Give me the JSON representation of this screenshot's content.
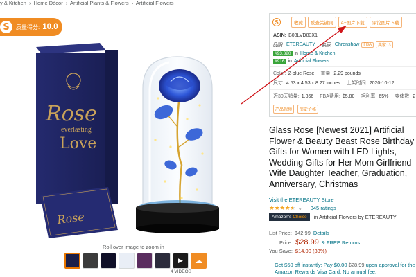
{
  "breadcrumb": [
    "y & Kitchen",
    "›",
    "Home Décor",
    "›",
    "Artificial Plants & Flowers",
    "›",
    "Artificial Flowers"
  ],
  "score": {
    "logo": "S",
    "label": "质量得分:",
    "value": "10.0"
  },
  "gallery": {
    "zoom_hint": "Roll over image to zoom in",
    "videos_label": "4 VIDEOS",
    "box_text_rose": "Rose",
    "box_text_everlasting": "everlasting",
    "box_text_love": "Love",
    "card_text": "Rose"
  },
  "panel": {
    "logo": "S",
    "tools": [
      "收藏",
      "反查关键词",
      "A+图片下载",
      "评论图片下载"
    ],
    "asin_label": "ASIN:",
    "asin": "B08LVD83X1",
    "brand_label": "品牌:",
    "brand": "ETEREAUTY",
    "seller_label": "卖家:",
    "seller": "Chrenshaw",
    "fba_tag": "FBA",
    "seller_count_tag": "卖家: 3",
    "rank1": "#93,320",
    "rank1_in": "in",
    "rank1_cat": "Home & Kitchen",
    "rank2": "#916",
    "rank2_in": "in",
    "rank2_cat": "Artificial Flowers",
    "color_label": "Color:",
    "color": "2-blue Rose",
    "weight_label": "重量:",
    "weight": "2.29 pounds",
    "size_label": "尺寸:",
    "size": "4.53 x 4.53 x 8.27 inches",
    "date_label": "上架时间:",
    "date": "2020-10-12",
    "sales_label": "近30天销量:",
    "sales": "1,866",
    "fba_fee_label": "FBA费用:",
    "fba_fee": "$5.80",
    "margin_label": "毛利率:",
    "margin": "65%",
    "variants_label": "变体数:",
    "variants": "2",
    "bottom_tags": [
      "产品视频",
      "历史价格"
    ]
  },
  "product": {
    "title_lines": [
      "Glass Rose [Newest 2021] Artificial",
      "Flower & Beauty Beast Rose Birthday",
      "Gifts for Women with LED Lights,",
      "Wedding Gifts for Her Mom Girlfriend",
      "Wife Daughter Teacher, Graduation,",
      "Anniversary, Christmas"
    ],
    "store_link": "Visit the ETEREAUTY Store",
    "rating_value": 4.5,
    "stars_glyphs": "★★★★★",
    "ratings_count": "345 ratings",
    "choice_prefix": "Amazon's",
    "choice_suffix": "Choice",
    "choice_in": "in Artificial Flowers by ETEREAUTY",
    "list_price_label": "List Price:",
    "list_price": "$42.99",
    "details": "Details",
    "price_label": "Price:",
    "price": "$28.99",
    "free_returns": "& FREE Returns",
    "save_label": "You Save:",
    "save_value": "$14.00 (33%)",
    "promo_line1_a": "Get $50 off instantly: Pay $0.00",
    "promo_line1_strike": "$28.99",
    "promo_line1_b": "upon approval for the",
    "promo_line2": "Amazon Rewards Visa Card. No annual fee."
  },
  "colors": {
    "accent": "#f08c23",
    "link": "#007185",
    "price": "#b12704",
    "annotation_arrow": "#d0161b"
  }
}
